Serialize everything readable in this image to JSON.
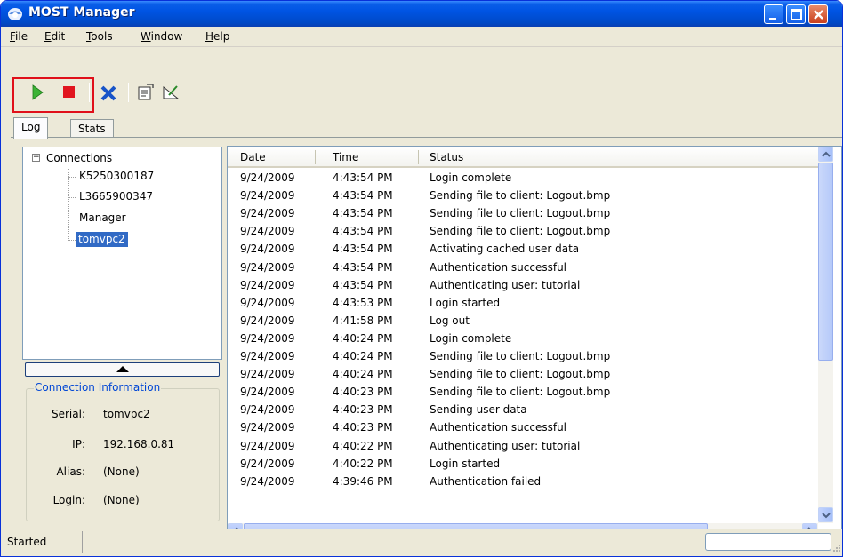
{
  "window": {
    "title": "MOST Manager"
  },
  "menu": [
    "File",
    "Edit",
    "Tools",
    "Window",
    "Help"
  ],
  "toolbar": {
    "buttons": [
      "play-icon",
      "stop-icon",
      "delete-icon",
      "properties-icon",
      "edit-tool-icon"
    ],
    "highlight_color": "#e0101a"
  },
  "tabs": [
    "Log",
    "Stats"
  ],
  "tree": {
    "root": "Connections",
    "items": [
      "K5250300187",
      "L3665900347",
      "Manager",
      "tomvpc2"
    ],
    "selected": "tomvpc2"
  },
  "connection_info": {
    "legend": "Connection Information",
    "fields": [
      {
        "label": "Serial:",
        "value": "tomvpc2"
      },
      {
        "label": "IP:",
        "value": "192.168.0.81"
      },
      {
        "label": "Alias:",
        "value": "(None)"
      },
      {
        "label": "Login:",
        "value": "(None)"
      }
    ]
  },
  "log": {
    "columns": [
      "Date",
      "Time",
      "Status"
    ],
    "rows": [
      [
        "9/24/2009",
        "4:43:54 PM",
        "Login complete"
      ],
      [
        "9/24/2009",
        "4:43:54 PM",
        "Sending file to client: Logout.bmp"
      ],
      [
        "9/24/2009",
        "4:43:54 PM",
        "Sending file to client: Logout.bmp"
      ],
      [
        "9/24/2009",
        "4:43:54 PM",
        "Sending file to client: Logout.bmp"
      ],
      [
        "9/24/2009",
        "4:43:54 PM",
        "Activating cached user data"
      ],
      [
        "9/24/2009",
        "4:43:54 PM",
        "Authentication successful"
      ],
      [
        "9/24/2009",
        "4:43:54 PM",
        "Authenticating user: tutorial"
      ],
      [
        "9/24/2009",
        "4:43:53 PM",
        "Login started"
      ],
      [
        "9/24/2009",
        "4:41:58 PM",
        "Log out"
      ],
      [
        "9/24/2009",
        "4:40:24 PM",
        "Login complete"
      ],
      [
        "9/24/2009",
        "4:40:24 PM",
        "Sending file to client: Logout.bmp"
      ],
      [
        "9/24/2009",
        "4:40:24 PM",
        "Sending file to client: Logout.bmp"
      ],
      [
        "9/24/2009",
        "4:40:23 PM",
        "Sending file to client: Logout.bmp"
      ],
      [
        "9/24/2009",
        "4:40:23 PM",
        "Sending user data"
      ],
      [
        "9/24/2009",
        "4:40:23 PM",
        "Authentication successful"
      ],
      [
        "9/24/2009",
        "4:40:22 PM",
        "Authenticating user: tutorial"
      ],
      [
        "9/24/2009",
        "4:40:22 PM",
        "Login started"
      ],
      [
        "9/24/2009",
        "4:39:46 PM",
        "Authentication failed"
      ]
    ]
  },
  "status": {
    "text": "Started"
  },
  "colors": {
    "titlebar": "#0054e3",
    "selection": "#316ac5",
    "group_legend": "#0046d5"
  }
}
